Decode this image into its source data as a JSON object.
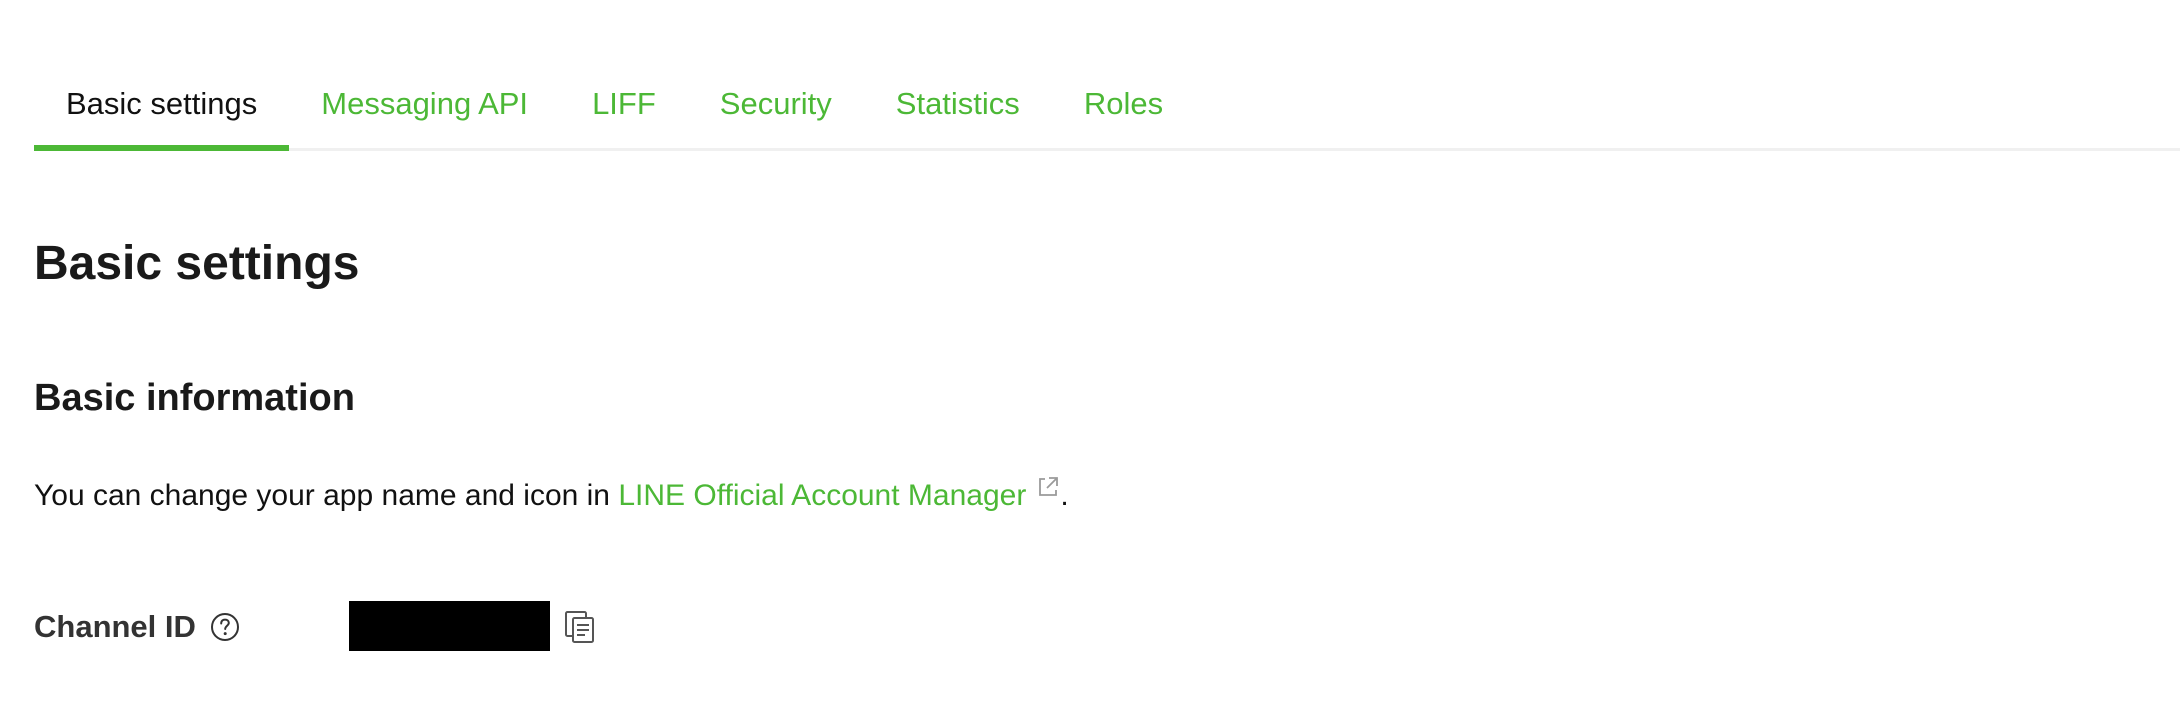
{
  "tabs": [
    {
      "label": "Basic settings",
      "active": true
    },
    {
      "label": "Messaging API",
      "active": false
    },
    {
      "label": "LIFF",
      "active": false
    },
    {
      "label": "Security",
      "active": false
    },
    {
      "label": "Statistics",
      "active": false
    },
    {
      "label": "Roles",
      "active": false
    }
  ],
  "page_title": "Basic settings",
  "section": {
    "title": "Basic information",
    "info_prefix": "You can change your app name and icon in ",
    "info_link": "LINE Official Account Manager",
    "info_suffix": "."
  },
  "fields": {
    "channel_id": {
      "label": "Channel ID",
      "value": "",
      "help_icon": "question-circle-icon",
      "copy_icon": "copy-icon"
    }
  },
  "colors": {
    "accent": "#4cb836",
    "text": "#111111",
    "tab_border": "#f0f0f0"
  }
}
